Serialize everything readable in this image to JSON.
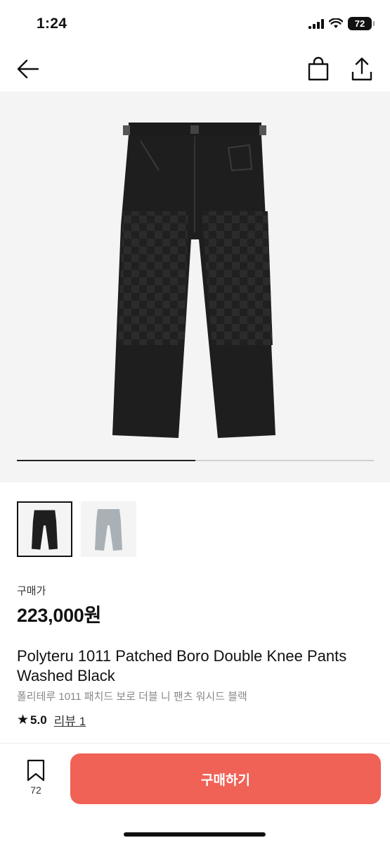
{
  "status_bar": {
    "time": "1:24",
    "battery": "72",
    "icons": [
      "cellular-signal-icon",
      "wifi-icon",
      "battery-icon"
    ]
  },
  "nav": {
    "icons": [
      "back-arrow-icon",
      "shopping-bag-icon",
      "share-icon"
    ]
  },
  "gallery": {
    "image_count": 2,
    "current_index": 1,
    "progress_fraction": 0.5
  },
  "price": {
    "label": "구매가",
    "value": "223,000원"
  },
  "product": {
    "title": "Polyteru 1011 Patched Boro Double Knee Pants Washed Black",
    "subtitle": "폴리테루 1011 패치드 보로 더블 니 팬츠 워시드 블랙",
    "rating": "5.0",
    "review_label": "리뷰 1"
  },
  "footer": {
    "wishlist_count": "72",
    "buy_label": "구매하기"
  },
  "colors": {
    "accent": "#f06256",
    "text": "#111111",
    "muted": "#888888",
    "image_bg": "#f4f4f4"
  }
}
